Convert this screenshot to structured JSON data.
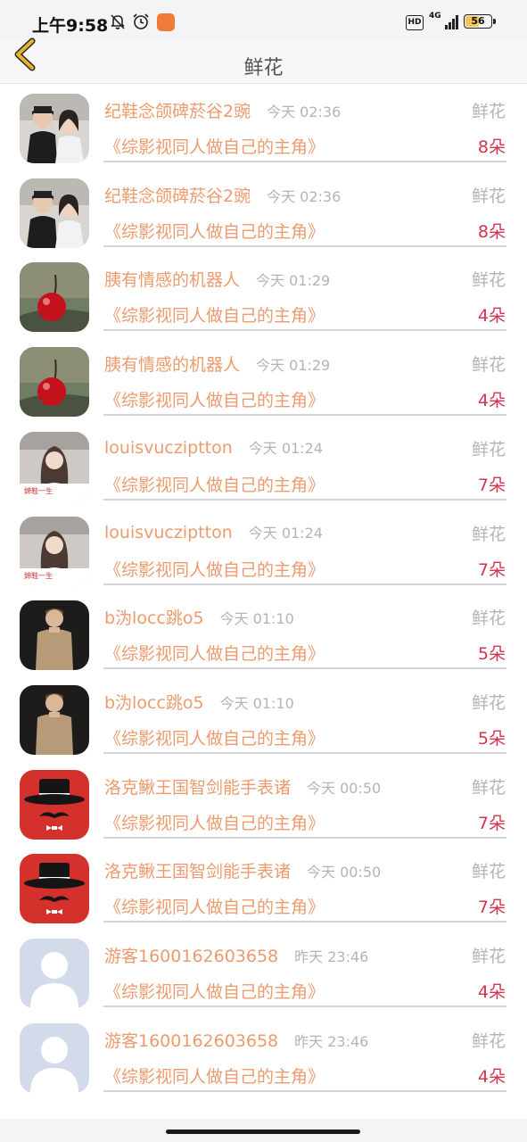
{
  "status_bar": {
    "time": "上午9:58",
    "hd_label": "HD",
    "network_label": "4G",
    "battery_level": "56",
    "battery_percent": 56
  },
  "header": {
    "title": "鲜花",
    "back_icon": "chevron-left-icon",
    "accent_color": "#e2b42e"
  },
  "colors": {
    "name": "#ec9b6e",
    "time": "#b4b4b8",
    "count": "#d2354e"
  },
  "items": [
    {
      "name": "纪鞋念颌碑菸谷2豌",
      "time": "今天 02:36",
      "type": "鲜花",
      "book": "《综影视同人做自己的主角》",
      "count": "8朵",
      "avatar": "couple-photo"
    },
    {
      "name": "纪鞋念颌碑菸谷2豌",
      "time": "今天 02:36",
      "type": "鲜花",
      "book": "《综影视同人做自己的主角》",
      "count": "8朵",
      "avatar": "couple-photo"
    },
    {
      "name": "胰有情感的机器人",
      "time": "今天 01:29",
      "type": "鲜花",
      "book": "《综影视同人做自己的主角》",
      "count": "4朵",
      "avatar": "cherry-photo"
    },
    {
      "name": "胰有情感的机器人",
      "time": "今天 01:29",
      "type": "鲜花",
      "book": "《综影视同人做自己的主角》",
      "count": "4朵",
      "avatar": "cherry-photo"
    },
    {
      "name": "louisvucziptton",
      "time": "今天 01:24",
      "type": "鲜花",
      "book": "《综影视同人做自己的主角》",
      "count": "7朵",
      "avatar": "girl-photo",
      "avatar_caption": "錦鞋一生"
    },
    {
      "name": "louisvucziptton",
      "time": "今天 01:24",
      "type": "鲜花",
      "book": "《综影视同人做自己的主角》",
      "count": "7朵",
      "avatar": "girl-photo",
      "avatar_caption": "錦鞋一生"
    },
    {
      "name": "b沩locc跳o5",
      "time": "今天 01:10",
      "type": "鲜花",
      "book": "《综影视同人做自己的主角》",
      "count": "5朵",
      "avatar": "man-photo"
    },
    {
      "name": "b沩locc跳o5",
      "time": "今天 01:10",
      "type": "鲜花",
      "book": "《综影视同人做自己的主角》",
      "count": "5朵",
      "avatar": "man-photo"
    },
    {
      "name": "洛克鳅王国智剑能手表诸",
      "time": "今天 00:50",
      "type": "鲜花",
      "book": "《综影视同人做自己的主角》",
      "count": "7朵",
      "avatar": "hat-mustache"
    },
    {
      "name": "洛克鳅王国智剑能手表诸",
      "time": "今天 00:50",
      "type": "鲜花",
      "book": "《综影视同人做自己的主角》",
      "count": "7朵",
      "avatar": "hat-mustache"
    },
    {
      "name": "游客1600162603658",
      "time": "昨天 23:46",
      "type": "鲜花",
      "book": "《综影视同人做自己的主角》",
      "count": "4朵",
      "avatar": "default-user"
    },
    {
      "name": "游客1600162603658",
      "time": "昨天 23:46",
      "type": "鲜花",
      "book": "《综影视同人做自己的主角》",
      "count": "4朵",
      "avatar": "default-user"
    }
  ]
}
